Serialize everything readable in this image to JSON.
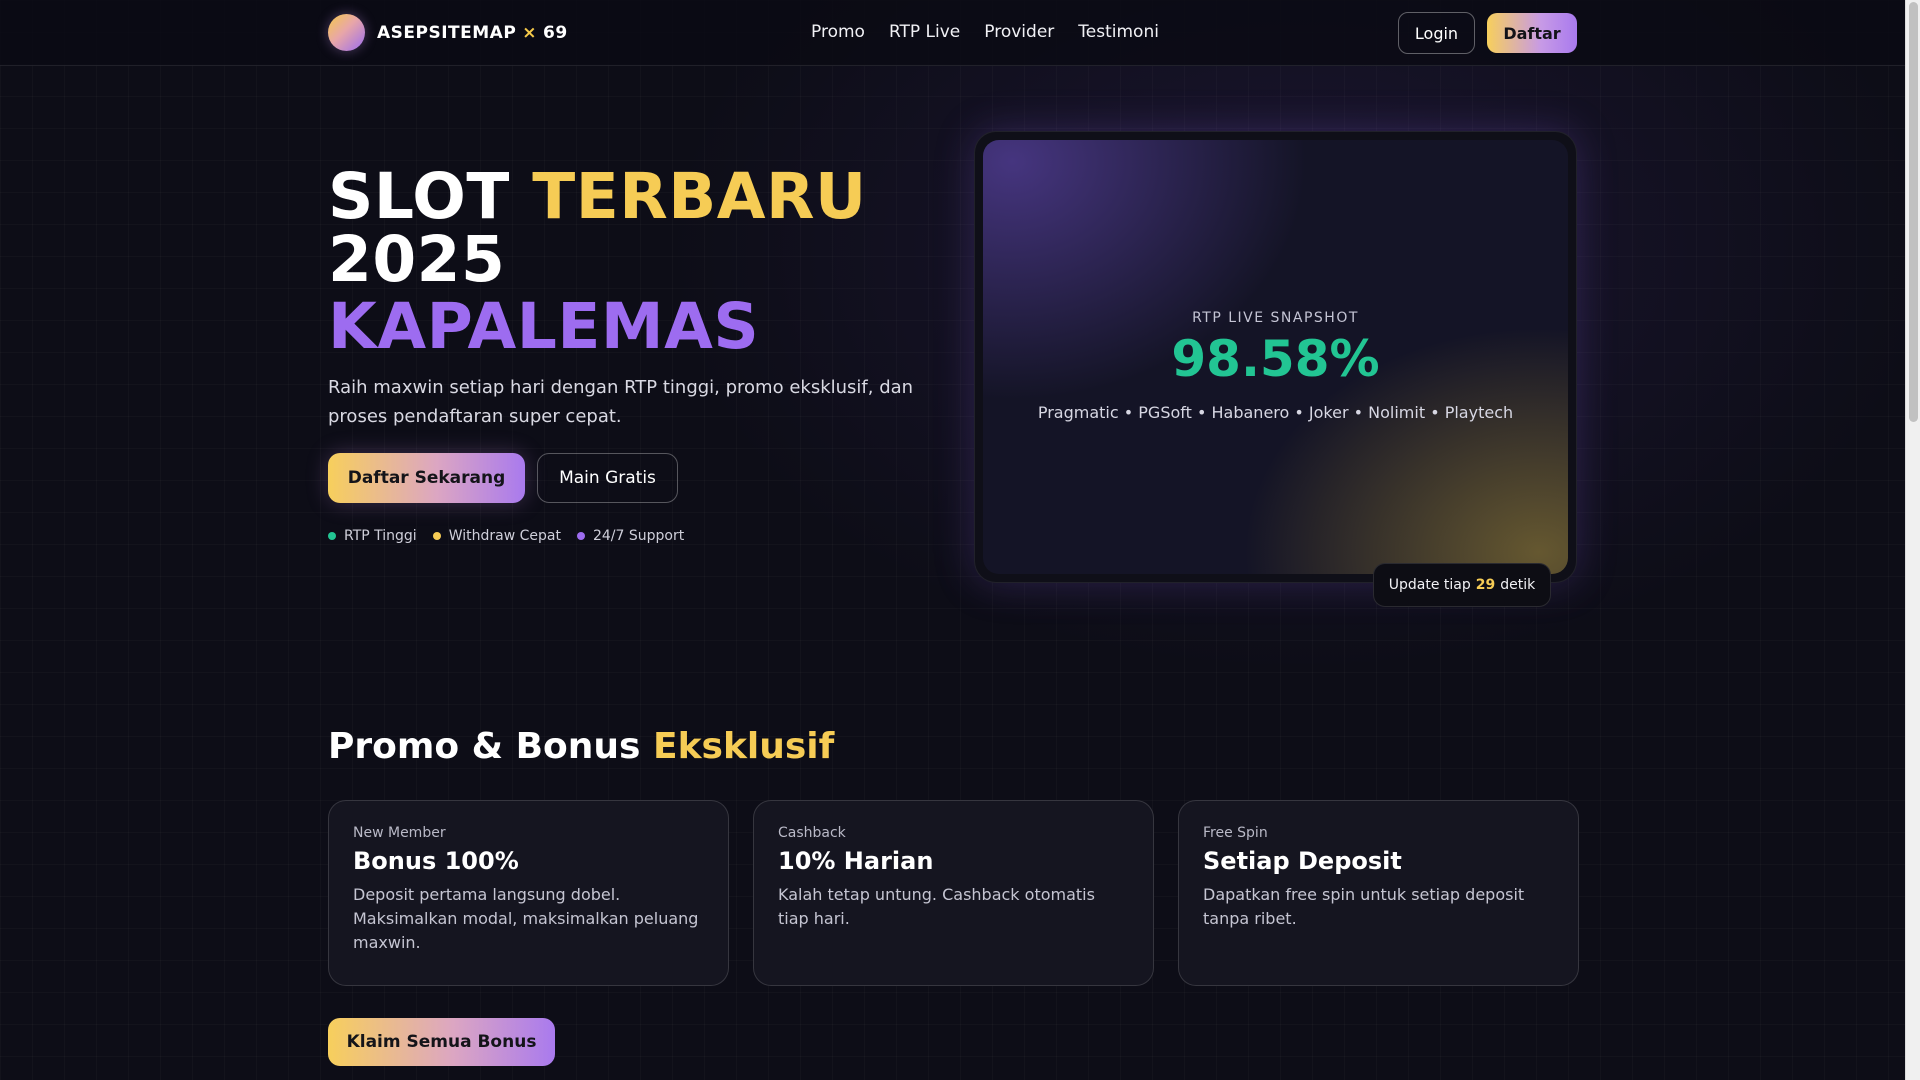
{
  "header": {
    "brand_name": "ASEPSITEMAP",
    "brand_x": "×",
    "brand_num": "69",
    "nav": [
      "Promo",
      "RTP Live",
      "Provider",
      "Testimoni"
    ],
    "login_label": "Login",
    "daftar_label": "Daftar"
  },
  "hero": {
    "title_word1": "SLOT",
    "title_word2": "TERBARU",
    "title_word3": "2025",
    "title_word4": "KAPALEMAS",
    "description": "Raih maxwin setiap hari dengan RTP tinggi, promo eksklusif, dan proses pendaftaran super cepat.",
    "primary_cta": "Daftar Sekarang",
    "secondary_cta": "Main Gratis",
    "features": [
      {
        "label": "RTP Tinggi",
        "color": "#22c593"
      },
      {
        "label": "Withdraw Cepat",
        "color": "#f6cc55"
      },
      {
        "label": "24/7 Support",
        "color": "#9d6cf0"
      }
    ]
  },
  "rtp": {
    "label": "RTP LIVE SNAPSHOT",
    "value": "98.58%",
    "providers": "Pragmatic • PGSoft • Habanero • Joker • Nolimit • Playtech",
    "update_prefix": "Update tiap",
    "update_seconds": "29",
    "update_suffix": "detik"
  },
  "promo": {
    "title_main": "Promo & Bonus",
    "title_accent": "Eksklusif",
    "cards": [
      {
        "tag": "New Member",
        "title": "Bonus 100%",
        "desc": "Deposit pertama langsung dobel. Maksimalkan modal, maksimalkan peluang maxwin."
      },
      {
        "tag": "Cashback",
        "title": "10% Harian",
        "desc": "Kalah tetap untung. Cashback otomatis tiap hari."
      },
      {
        "tag": "Free Spin",
        "title": "Setiap Deposit",
        "desc": "Dapatkan free spin untuk setiap deposit tanpa ribet."
      }
    ],
    "claim_label": "Klaim Semua Bonus"
  },
  "colors": {
    "accent_yellow": "#f6cc55",
    "accent_purple": "#9d6cf0",
    "accent_green": "#22c593",
    "background": "#0d0d17"
  }
}
